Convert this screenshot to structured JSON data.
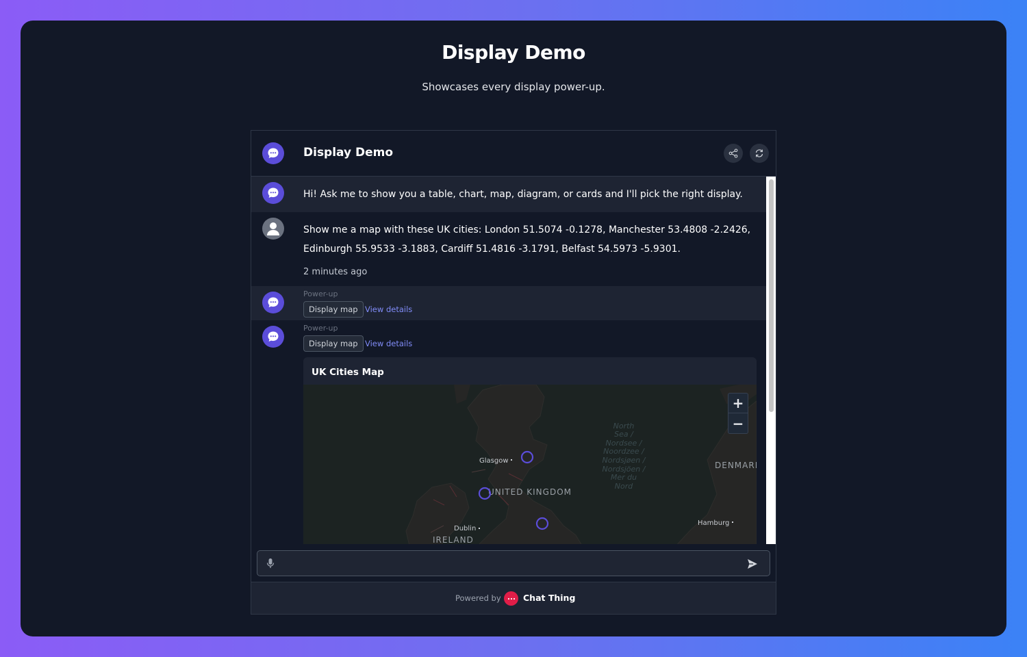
{
  "page": {
    "title": "Display Demo",
    "subtitle": "Showcases every display power-up."
  },
  "widget": {
    "title": "Display Demo",
    "header_icons": [
      "share-icon",
      "refresh-icon"
    ]
  },
  "messages": {
    "greeting": "Hi! Ask me to show you a table, chart, map, diagram, or cards and I'll pick the right display.",
    "user_line1": "Show me a map with these UK cities: London 51.5074 -0.1278, Manchester 53.4808 -2.2426,",
    "user_line2": "Edinburgh 55.9533 -3.1883, Cardiff 51.4816 -3.1791, Belfast 54.5973 -5.9301.",
    "timestamp": "2 minutes ago",
    "powerups": [
      {
        "label": "Power-up",
        "badge": "Display map",
        "link": "View details"
      },
      {
        "label": "Power-up",
        "badge": "Display map",
        "link": "View details"
      }
    ]
  },
  "map": {
    "title": "UK Cities Map",
    "zoom_in": "+",
    "zoom_out": "−",
    "labels": {
      "glasgow": "Glasgow",
      "dublin": "Dublin",
      "hamburg": "Hamburg",
      "uk": "UNITED KINGDOM",
      "ireland": "IRELAND",
      "denmark": "DENMARI",
      "sea1": "North",
      "sea2": "Sea /",
      "sea3": "Nordsee /",
      "sea4": "Noordzee /",
      "sea5": "Nordsjøen /",
      "sea6": "Nordsjöen /",
      "sea7": "Mer du",
      "sea8": "Nord"
    },
    "marker_color": "#5b4dd9"
  },
  "composer": {
    "placeholder": ""
  },
  "footer": {
    "powered_by": "Powered by",
    "brand": "Chat Thing"
  }
}
